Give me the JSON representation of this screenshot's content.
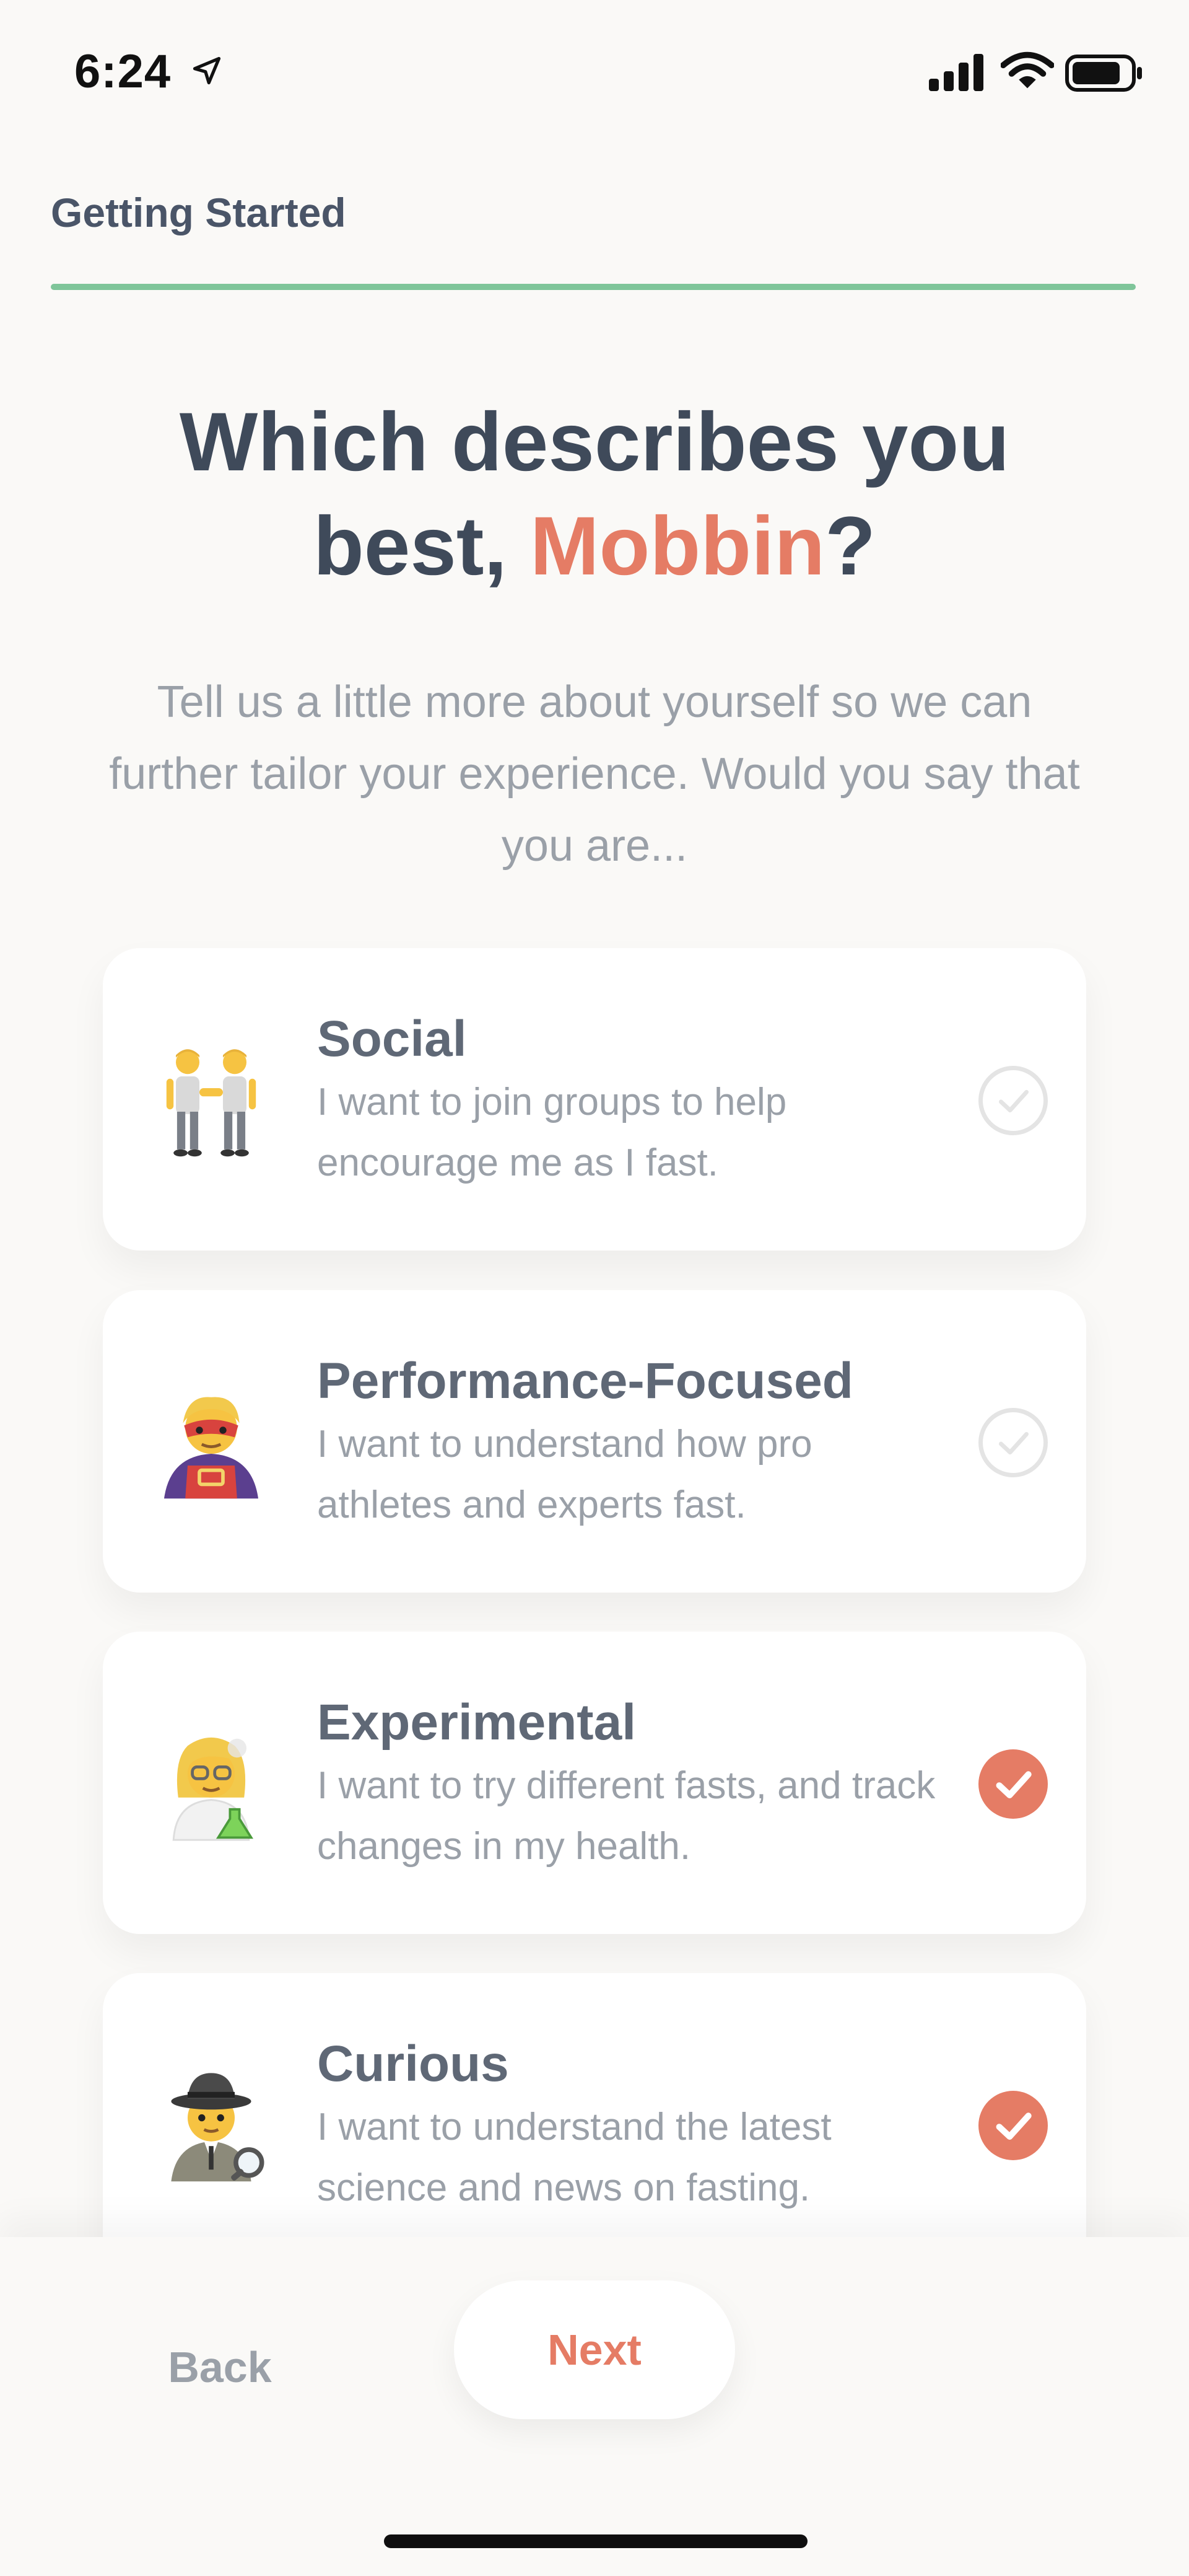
{
  "status_bar": {
    "time": "6:24",
    "icons": [
      "location-arrow-icon",
      "cellular-signal-icon",
      "wifi-icon",
      "battery-icon"
    ]
  },
  "header": {
    "title": "Getting Started",
    "progress_color": "#7fc59a"
  },
  "heading": {
    "prefix": "Which describes you best, ",
    "name": "Mobbin",
    "suffix": "?",
    "accent_color": "#e57c65"
  },
  "subtitle": "Tell us a little more about yourself so we can further tailor your experience. Would you say that you are...",
  "options": [
    {
      "title": "Social",
      "description": "I want to join groups to help encourage me as I fast.",
      "emoji": "people-holding-hands-icon",
      "selected": false
    },
    {
      "title": "Performance-Focused",
      "description": "I want to understand how pro athletes and experts fast.",
      "emoji": "superhero-icon",
      "selected": false
    },
    {
      "title": "Experimental",
      "description": "I want to try different fasts, and track changes in my health.",
      "emoji": "scientist-icon",
      "selected": true
    },
    {
      "title": "Curious",
      "description": "I want to understand the latest science and news on fasting.",
      "emoji": "detective-icon",
      "selected": true
    }
  ],
  "footer": {
    "back_label": "Back",
    "next_label": "Next"
  },
  "colors": {
    "accent": "#e57c65",
    "progress": "#7fc59a",
    "background": "#faf9f7"
  }
}
